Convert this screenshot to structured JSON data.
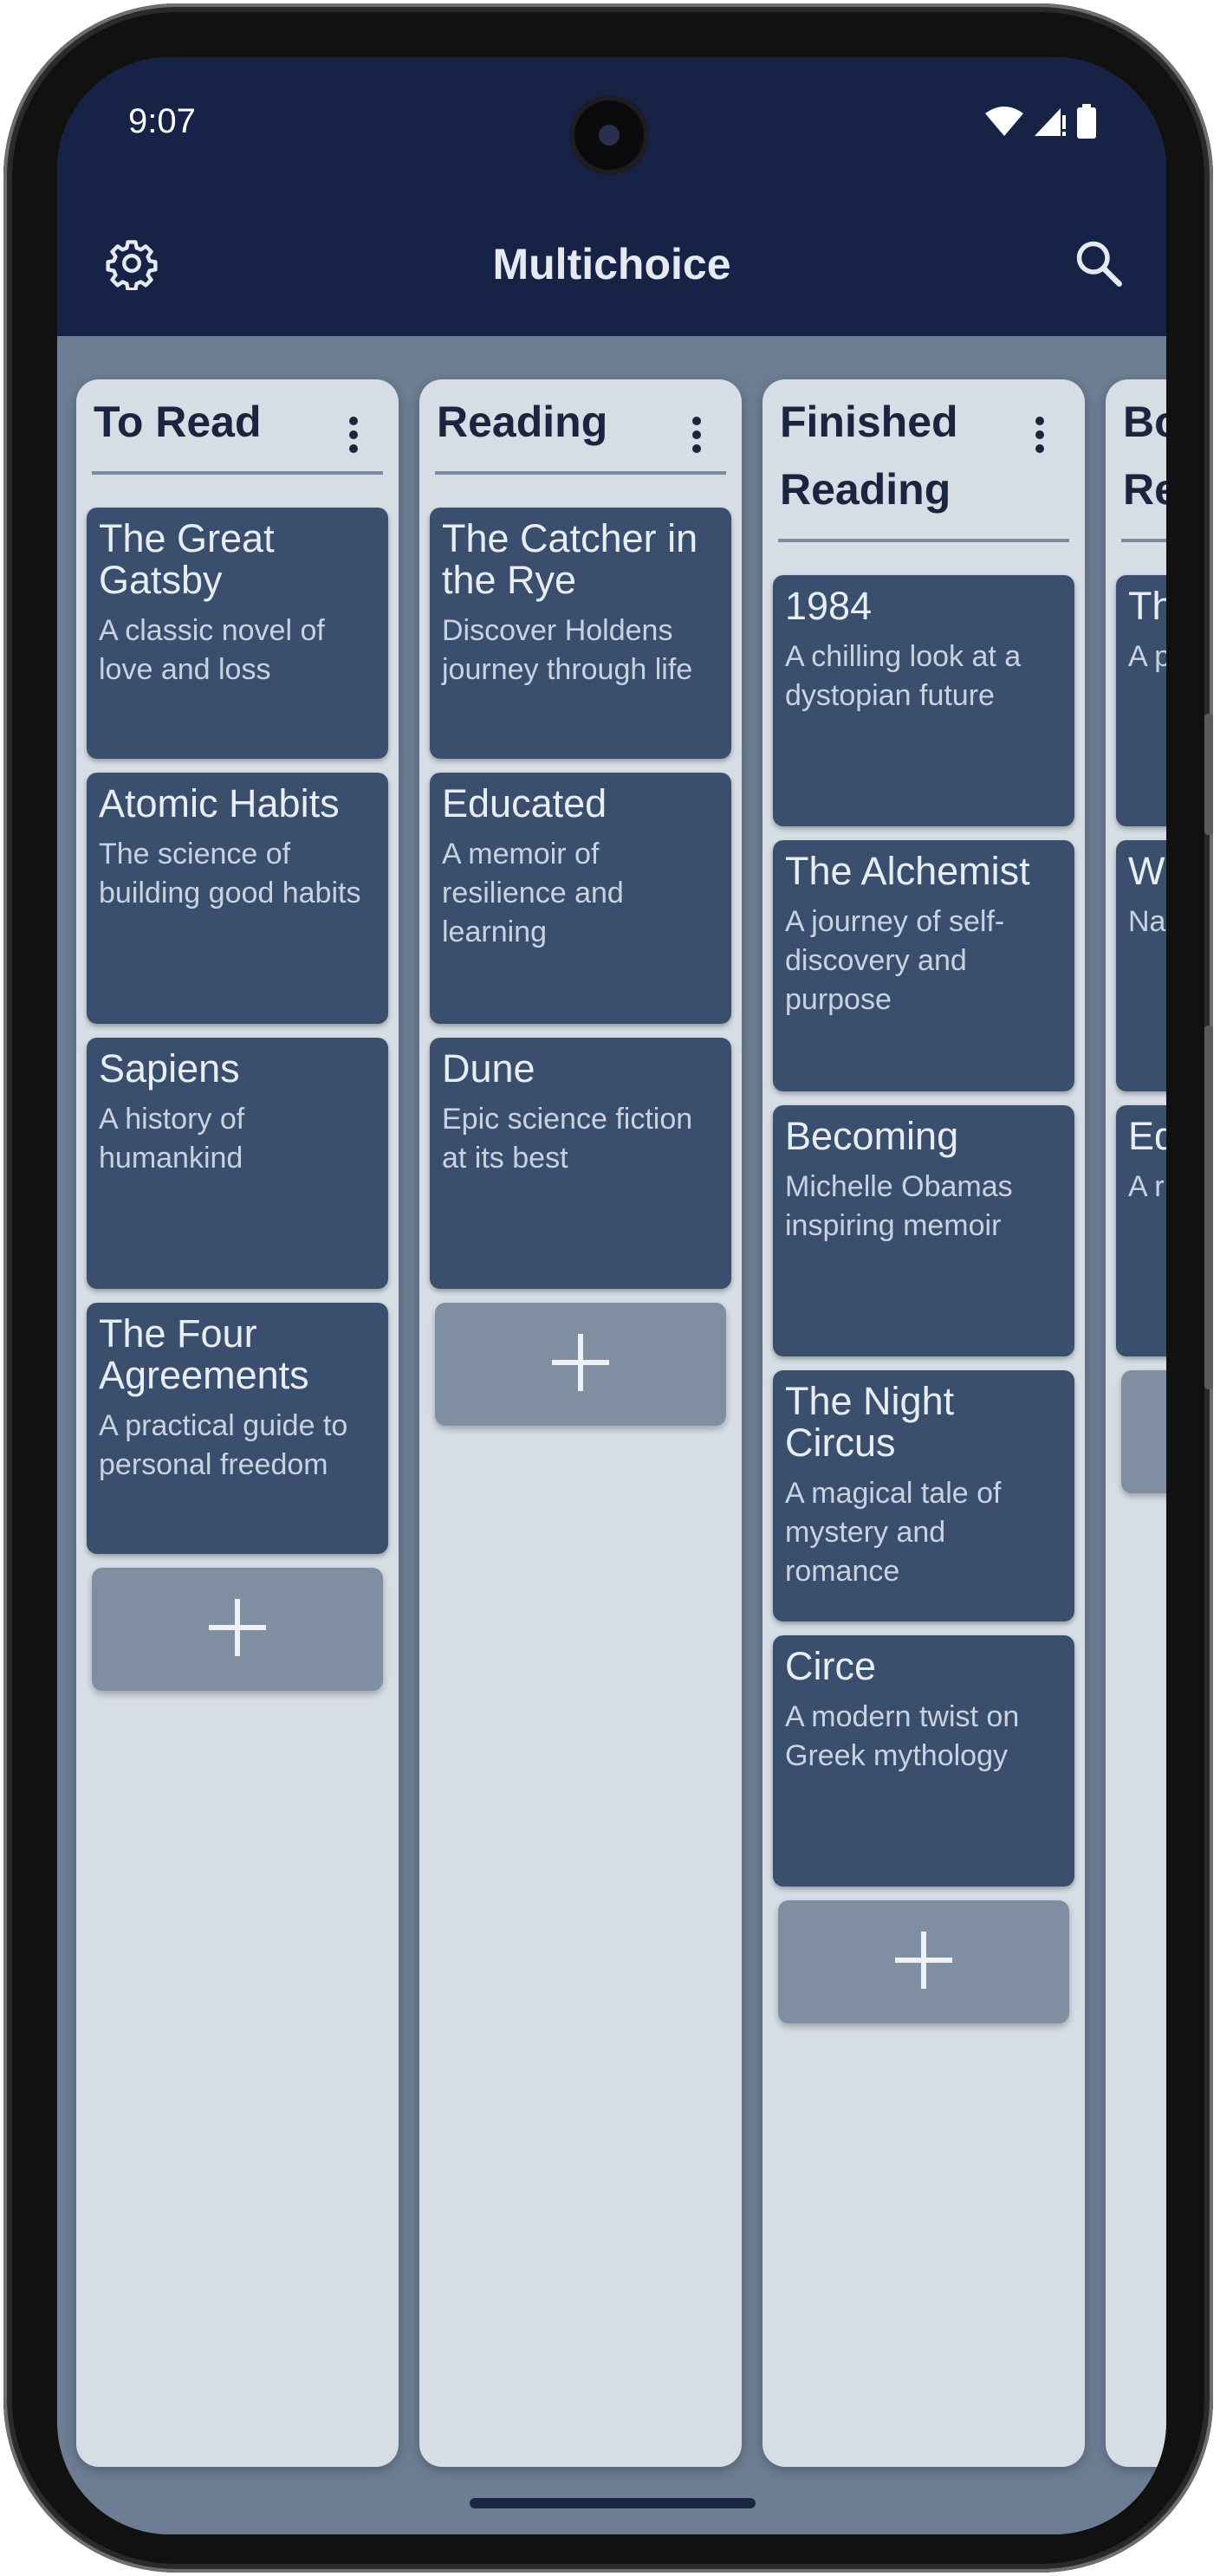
{
  "status": {
    "time": "9:07"
  },
  "app": {
    "title": "Multichoice"
  },
  "columns": [
    {
      "title": "To Read",
      "cards": [
        {
          "title": "The Great Gatsby",
          "description": "A classic novel of love and loss"
        },
        {
          "title": "Atomic Habits",
          "description": "The science of building good habits"
        },
        {
          "title": "Sapiens",
          "description": "A history of humankind"
        },
        {
          "title": "The Four Agreements",
          "description": "A practical guide to personal freedom"
        }
      ]
    },
    {
      "title": "Reading",
      "cards": [
        {
          "title": "The Catcher in the Rye",
          "description": "Discover Holdens journey through life"
        },
        {
          "title": "Educated",
          "description": "A memoir of resilience and learning"
        },
        {
          "title": "Dune",
          "description": "Epic science fiction at its best"
        }
      ]
    },
    {
      "title": "Finished Reading",
      "cards": [
        {
          "title": "1984",
          "description": "A chilling look at a dystopian future"
        },
        {
          "title": "The Alchemist",
          "description": "A journey of self-discovery and purpose"
        },
        {
          "title": "Becoming",
          "description": "Michelle Obamas inspiring memoir"
        },
        {
          "title": "The Night Circus",
          "description": "A magical tale of mystery and romance"
        },
        {
          "title": "Circe",
          "description": "A modern twist on Greek mythology"
        }
      ]
    },
    {
      "title": "Book Recommendations",
      "cards": [
        {
          "title": "The Paulo",
          "description": "A p thr yo"
        },
        {
          "title": "W Cr",
          "description": "Na an"
        },
        {
          "title": "Ed",
          "description": "A r of ad"
        }
      ]
    }
  ],
  "icons": {
    "settings": "gear-icon",
    "search": "search-icon",
    "menu": "more-vert-icon",
    "add": "plus-icon",
    "wifi": "wifi-icon",
    "signal": "signal-icon",
    "battery": "battery-icon"
  },
  "colors": {
    "app_bar": "#162246",
    "board_bg": "#6d7e94",
    "column_bg": "#d6dde5",
    "card_bg": "#3a4f6e",
    "add_button": "#808ea1"
  }
}
